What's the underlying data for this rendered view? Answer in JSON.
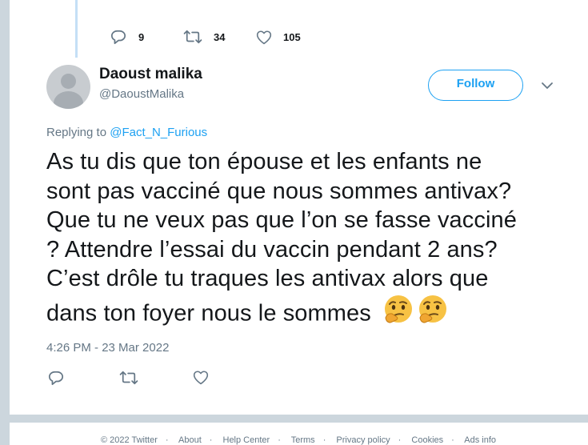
{
  "previous_tweet": {
    "reply_count": "9",
    "retweet_count": "34",
    "like_count": "105"
  },
  "tweet": {
    "author_name": "Daoust malika",
    "author_handle": "@DaoustMalika",
    "follow_label": "Follow",
    "replying_to_prefix": "Replying to",
    "replying_to_handle": "@Fact_N_Furious",
    "text_lines": [
      "As tu dis que ton épouse et les enfants ne",
      "sont pas vacciné que nous sommes antivax?",
      "Que tu ne veux pas que l’on se fasse vacciné",
      "? Attendre l’essai du vaccin pendant 2 ans?",
      "C’est drôle tu traques les antivax alors que",
      "dans ton foyer nous le sommes"
    ],
    "emojis": [
      "thinking-face",
      "thinking-face"
    ],
    "timestamp": "4:26 PM - 23 Mar 2022"
  },
  "icons": {
    "reply": "reply-icon",
    "retweet": "retweet-icon",
    "like": "heart-icon",
    "more": "chevron-down-icon"
  },
  "colors": {
    "accent": "#1da1f2",
    "muted": "#657786",
    "thread_line": "#c4dff6",
    "page_bg": "#ccd6dd"
  },
  "footer": {
    "copyright": "© 2022 Twitter",
    "links": [
      "About",
      "Help Center",
      "Terms",
      "Privacy policy",
      "Cookies",
      "Ads info"
    ]
  }
}
